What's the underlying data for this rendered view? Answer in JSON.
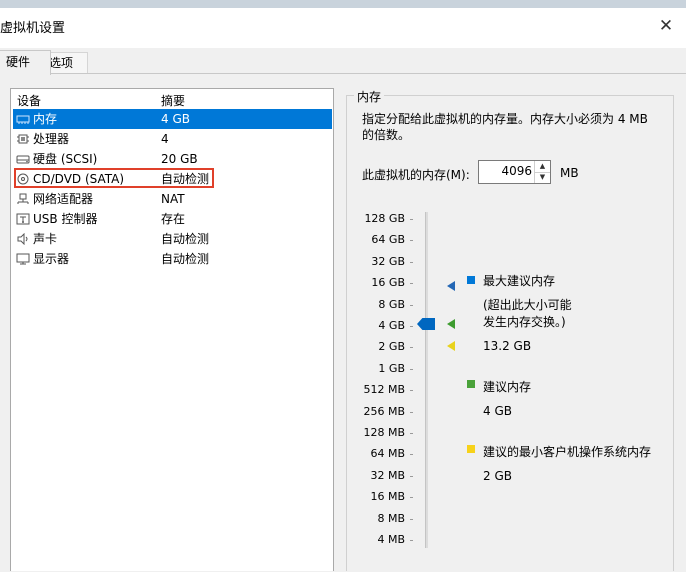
{
  "window": {
    "title": "虚拟机设置",
    "close_glyph": "✕"
  },
  "tabs": [
    {
      "label": "硬件",
      "active": true
    },
    {
      "label": "选项",
      "active": false
    }
  ],
  "device_list": {
    "headers": {
      "device": "设备",
      "summary": "摘要"
    },
    "rows": [
      {
        "name": "内存",
        "summary": "4 GB",
        "icon": "memory-icon",
        "selected": true
      },
      {
        "name": "处理器",
        "summary": "4",
        "icon": "processor-icon",
        "selected": false
      },
      {
        "name": "硬盘 (SCSI)",
        "summary": "20 GB",
        "icon": "hard-disk-icon",
        "selected": false
      },
      {
        "name": "CD/DVD (SATA)",
        "summary": "自动检测",
        "icon": "cd-dvd-icon",
        "selected": false
      },
      {
        "name": "网络适配器",
        "summary": "NAT",
        "icon": "network-adapter-icon",
        "selected": false
      },
      {
        "name": "USB 控制器",
        "summary": "存在",
        "icon": "usb-controller-icon",
        "selected": false
      },
      {
        "name": "声卡",
        "summary": "自动检测",
        "icon": "sound-card-icon",
        "selected": false
      },
      {
        "name": "显示器",
        "summary": "自动检测",
        "icon": "display-icon",
        "selected": false
      }
    ],
    "highlighted_row": "CD/DVD (SATA)",
    "highlight_color": "#e0402a"
  },
  "memory": {
    "group_label": "内存",
    "description": "指定分配给此虚拟机的内存量。内存大小必须为 4 MB 的倍数。",
    "field_label": "此虚拟机的内存(M):",
    "value": "4096",
    "unit": "MB",
    "scale_labels": [
      "128 GB",
      "64 GB",
      "32 GB",
      "16 GB",
      "8 GB",
      "4 GB",
      "2 GB",
      "1 GB",
      "512 MB",
      "256 MB",
      "128 MB",
      "64 MB",
      "32 MB",
      "16 MB",
      "8 MB",
      "4 MB"
    ],
    "slider_value": "4 GB",
    "legend": {
      "max_recommended": {
        "title": "最大建议内存",
        "note": "(超出此大小可能\n发生内存交换。)",
        "value": "13.2 GB",
        "color": "#0078d7"
      },
      "recommended": {
        "title": "建议内存",
        "value": "4 GB",
        "color": "#4aa23a"
      },
      "min_guest": {
        "title": "建议的最小客户机操作系统内存",
        "value": "2 GB",
        "color": "#f7d21a"
      }
    }
  },
  "colors": {
    "selection": "#0078d7",
    "background": "#f0f0f0"
  }
}
